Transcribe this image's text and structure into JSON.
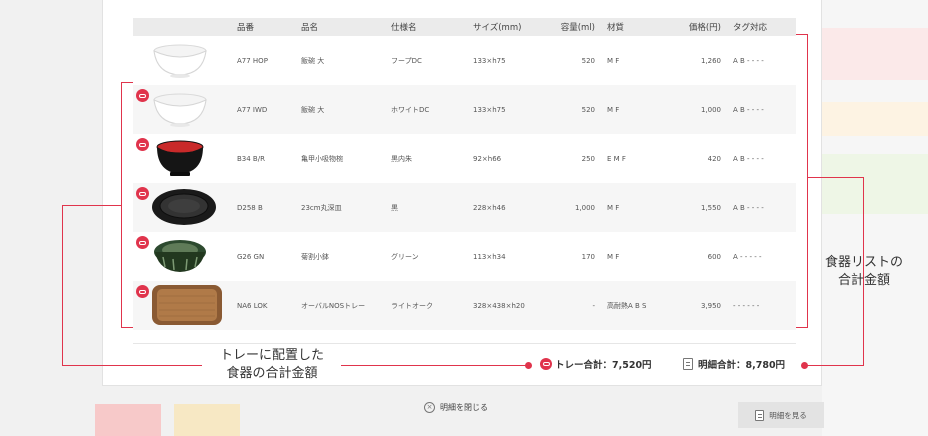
{
  "colors": {
    "accent": "#e0344c"
  },
  "table": {
    "headers": [
      "",
      "品番",
      "品名",
      "仕様名",
      "サイズ(mm)",
      "容量(ml)",
      "材質",
      "価格(円)",
      "タグ対応"
    ],
    "rows": [
      {
        "code": "A77 HOP",
        "name": "飯碗 大",
        "spec": "フープDC",
        "size": "133×h75",
        "volume": "520",
        "material": "M F",
        "price": "1,260",
        "tag": "A B - - - -",
        "on_tray": false,
        "dish": "white-bowl"
      },
      {
        "code": "A77 IWD",
        "name": "飯碗 大",
        "spec": "ホワイトDC",
        "size": "133×h75",
        "volume": "520",
        "material": "M F",
        "price": "1,000",
        "tag": "A B - - - -",
        "on_tray": true,
        "dish": "white-bowl"
      },
      {
        "code": "B34 B/R",
        "name": "亀甲小吸物椀",
        "spec": "黒内朱",
        "size": "92×h66",
        "volume": "250",
        "material": "E M F",
        "price": "420",
        "tag": "A B - - - -",
        "on_tray": true,
        "dish": "black-red-bowl"
      },
      {
        "code": "D258 B",
        "name": "23cm丸深皿",
        "spec": "黒",
        "size": "228×h46",
        "volume": "1,000",
        "material": "M F",
        "price": "1,550",
        "tag": "A B - - - -",
        "on_tray": true,
        "dish": "black-plate"
      },
      {
        "code": "G26 GN",
        "name": "菊割小鉢",
        "spec": "グリーン",
        "size": "113×h34",
        "volume": "170",
        "material": "M F",
        "price": "600",
        "tag": "A - - - - -",
        "on_tray": true,
        "dish": "green-bowl"
      },
      {
        "code": "NA6 LOK",
        "name": "オーバルNOSトレー",
        "spec": "ライトオーク",
        "size": "328×438×h20",
        "volume": "-",
        "material": "高耐熱A B S",
        "price": "3,950",
        "tag": "- - - - - -",
        "on_tray": true,
        "dish": "oak-tray"
      }
    ]
  },
  "totals": {
    "tray_label": "トレー合計：7,520円",
    "detail_label": "明細合計：8,780円"
  },
  "buttons": {
    "close_details": "明細を閉じる",
    "view_details": "明細を見る"
  },
  "callouts": {
    "tray_total_line1": "トレーに配置した",
    "tray_total_line2": "食器の合計金額",
    "list_total_line1": "食器リストの",
    "list_total_line2": "合計金額"
  }
}
